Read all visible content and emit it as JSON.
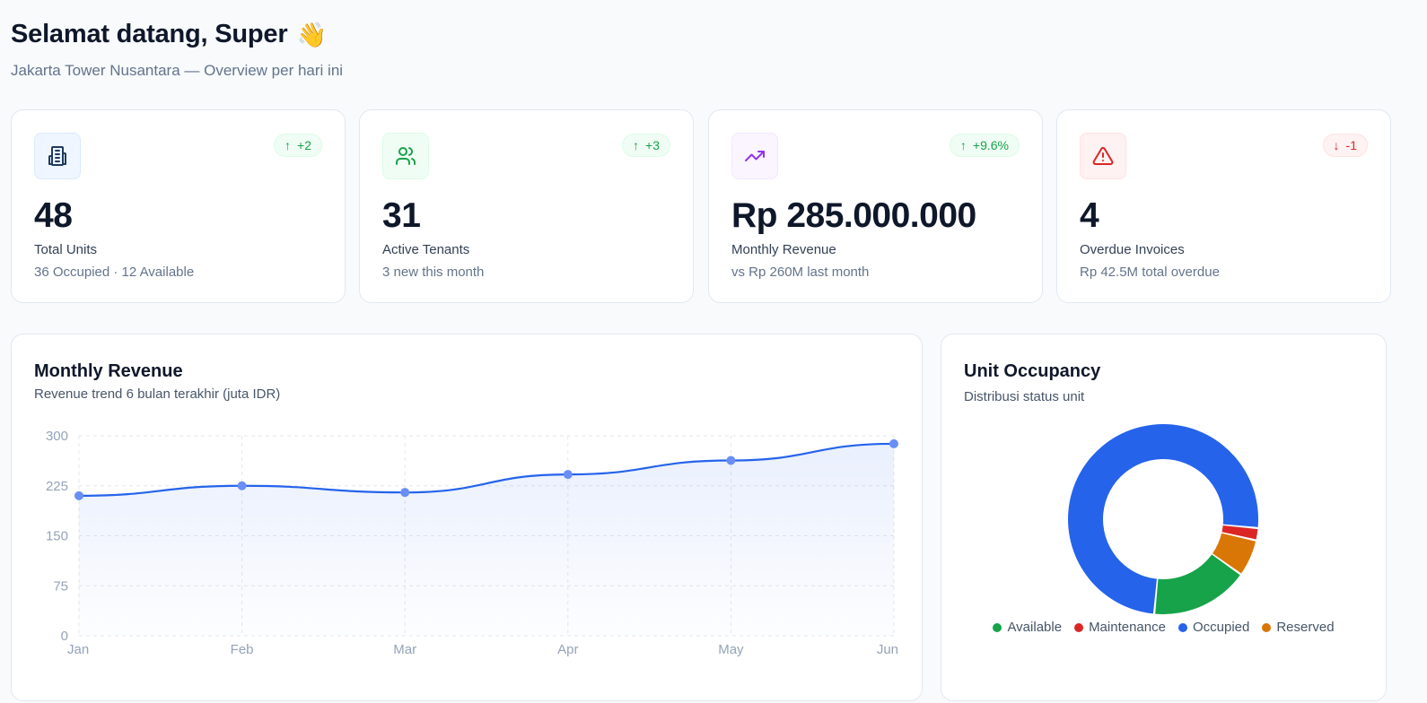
{
  "header": {
    "greeting": "Selamat datang, Super",
    "wave": "👋",
    "subtitle": "Jakarta Tower Nusantara — Overview per hari ini"
  },
  "stats": [
    {
      "value": "48",
      "label": "Total Units",
      "sub": "36 Occupied · 12 Available",
      "badge": "+2",
      "trend": "up",
      "icon": "building-icon",
      "color": "#1e3a5f"
    },
    {
      "value": "31",
      "label": "Active Tenants",
      "sub": "3 new this month",
      "badge": "+3",
      "trend": "up",
      "icon": "users-icon",
      "color": "#16a34a"
    },
    {
      "value": "Rp 285.000.000",
      "label": "Monthly Revenue",
      "sub": "vs Rp 260M last month",
      "badge": "+9.6%",
      "trend": "up",
      "icon": "trending-up-icon",
      "color": "#9333ea"
    },
    {
      "value": "4",
      "label": "Overdue Invoices",
      "sub": "Rp 42.5M total overdue",
      "badge": "-1",
      "trend": "down",
      "icon": "alert-triangle-icon",
      "color": "#dc2626"
    }
  ],
  "revenue_panel": {
    "title": "Monthly Revenue",
    "subtitle": "Revenue trend 6 bulan terakhir (juta IDR)"
  },
  "occupancy_panel": {
    "title": "Unit Occupancy",
    "subtitle": "Distribusi status unit",
    "legend": [
      {
        "label": "Available",
        "color": "#16a34a"
      },
      {
        "label": "Maintenance",
        "color": "#dc2626"
      },
      {
        "label": "Occupied",
        "color": "#2563eb"
      },
      {
        "label": "Reserved",
        "color": "#d97706"
      }
    ]
  },
  "chart_data": [
    {
      "type": "area",
      "title": "Monthly Revenue",
      "categories": [
        "Jan",
        "Feb",
        "Mar",
        "Apr",
        "May",
        "Jun"
      ],
      "values": [
        210,
        225,
        215,
        242,
        263,
        288
      ],
      "ylim": [
        0,
        300
      ],
      "yticks": [
        0,
        75,
        150,
        225,
        300
      ],
      "color": "#2563eb",
      "grid": true
    },
    {
      "type": "pie",
      "title": "Unit Occupancy",
      "donut": true,
      "slices": [
        {
          "label": "Occupied",
          "value": 36,
          "color": "#2563eb"
        },
        {
          "label": "Maintenance",
          "value": 1,
          "color": "#dc2626"
        },
        {
          "label": "Reserved",
          "value": 3,
          "color": "#d97706"
        },
        {
          "label": "Available",
          "value": 8,
          "color": "#16a34a"
        }
      ]
    }
  ]
}
